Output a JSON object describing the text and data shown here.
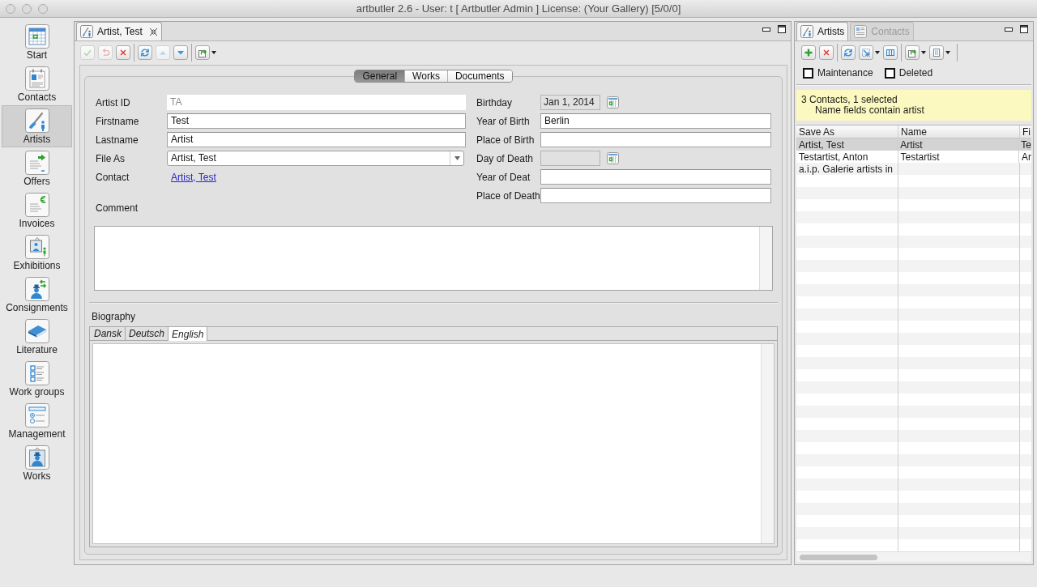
{
  "window": {
    "title": "artbutler 2.6 - User: t [ Artbutler Admin ] License: (Your Gallery) [5/0/0]"
  },
  "sidebar": {
    "items": [
      {
        "label": "Start",
        "selected": false
      },
      {
        "label": "Contacts",
        "selected": false
      },
      {
        "label": "Artists",
        "selected": true
      },
      {
        "label": "Offers",
        "selected": false
      },
      {
        "label": "Invoices",
        "selected": false
      },
      {
        "label": "Exhibitions",
        "selected": false
      },
      {
        "label": "Consignments",
        "selected": false
      },
      {
        "label": "Literature",
        "selected": false
      },
      {
        "label": "Work groups",
        "selected": false
      },
      {
        "label": "Management",
        "selected": false
      },
      {
        "label": "Works",
        "selected": false
      }
    ]
  },
  "editor": {
    "tabs": [
      {
        "label": "Artist, Test",
        "selected": true
      }
    ],
    "toolbar": [
      {
        "buttons": [
          {
            "kind": "confirm",
            "disabled": true,
            "dropdown": false
          },
          {
            "kind": "undo",
            "disabled": true,
            "dropdown": false
          },
          {
            "kind": "delete",
            "disabled": false,
            "dropdown": false
          }
        ]
      },
      {
        "buttons": [
          {
            "kind": "refresh",
            "disabled": false,
            "dropdown": false
          },
          {
            "kind": "up",
            "disabled": true,
            "dropdown": false
          },
          {
            "kind": "down",
            "disabled": false,
            "dropdown": false
          }
        ]
      },
      {
        "buttons": [
          {
            "kind": "export",
            "disabled": false,
            "dropdown": true
          }
        ]
      }
    ],
    "section_tabs": [
      {
        "label": "General",
        "selected": true
      },
      {
        "label": "Works",
        "selected": false
      },
      {
        "label": "Documents",
        "selected": false
      }
    ],
    "fields_left": [
      {
        "kind": "readonly",
        "label": "Artist ID",
        "value": "TA"
      },
      {
        "kind": "text",
        "label": "Firstname",
        "value": "Test"
      },
      {
        "kind": "text",
        "label": "Lastname",
        "value": "Artist"
      },
      {
        "kind": "dropdown",
        "label": "File As",
        "value": "Artist, Test"
      },
      {
        "kind": "link",
        "label": "Contact",
        "value": "Artist, Test"
      }
    ],
    "fields_right": [
      {
        "kind": "date",
        "label": "Birthday",
        "value": "Jan 1, 2014"
      },
      {
        "kind": "text",
        "label": "Year of Birth",
        "value": "Berlin"
      },
      {
        "kind": "text",
        "label": "Place of Birth"
      },
      {
        "kind": "date",
        "label": "Day of Death"
      },
      {
        "kind": "text",
        "label": "Year of Deat"
      },
      {
        "kind": "text",
        "label": "Place of Death"
      }
    ],
    "comment": {
      "label": "Comment"
    },
    "biography": {
      "label": "Biography",
      "tabs": [
        {
          "label": "Dansk",
          "selected": false
        },
        {
          "label": "Deutsch",
          "selected": false
        },
        {
          "label": "English",
          "selected": true
        }
      ]
    }
  },
  "list_panel": {
    "tabs": [
      {
        "label": "Artists",
        "selected": true
      },
      {
        "label": "Contacts",
        "selected": false
      }
    ],
    "toolbar": [
      {
        "buttons": [
          {
            "kind": "add",
            "disabled": false,
            "dropdown": false
          },
          {
            "kind": "delete",
            "disabled": false,
            "dropdown": false
          }
        ]
      },
      {
        "buttons": [
          {
            "kind": "refresh",
            "disabled": false,
            "dropdown": false
          },
          {
            "kind": "select",
            "disabled": false,
            "dropdown": true
          },
          {
            "kind": "columns",
            "disabled": false,
            "dropdown": false
          }
        ]
      },
      {
        "buttons": [
          {
            "kind": "export",
            "disabled": false,
            "dropdown": true
          },
          {
            "kind": "list",
            "disabled": false,
            "dropdown": true
          }
        ]
      }
    ],
    "filters": [
      {
        "label": "Maintenance",
        "checked": false
      },
      {
        "label": "Deleted",
        "checked": false
      }
    ],
    "info": {
      "summary": "3 Contacts, 1 selected",
      "filter": "Name fields contain artist"
    },
    "table": {
      "columns": [
        "Save As",
        "Name",
        "Fi"
      ],
      "rows": [
        {
          "cells": [
            "Artist, Test",
            "Artist",
            "Te"
          ],
          "selected": true
        },
        {
          "cells": [
            "Testartist, Anton",
            "Testartist",
            "Ar"
          ],
          "selected": false
        },
        {
          "cells": [
            "a.i.p. Galerie artists in"
          ],
          "selected": false
        }
      ]
    }
  }
}
